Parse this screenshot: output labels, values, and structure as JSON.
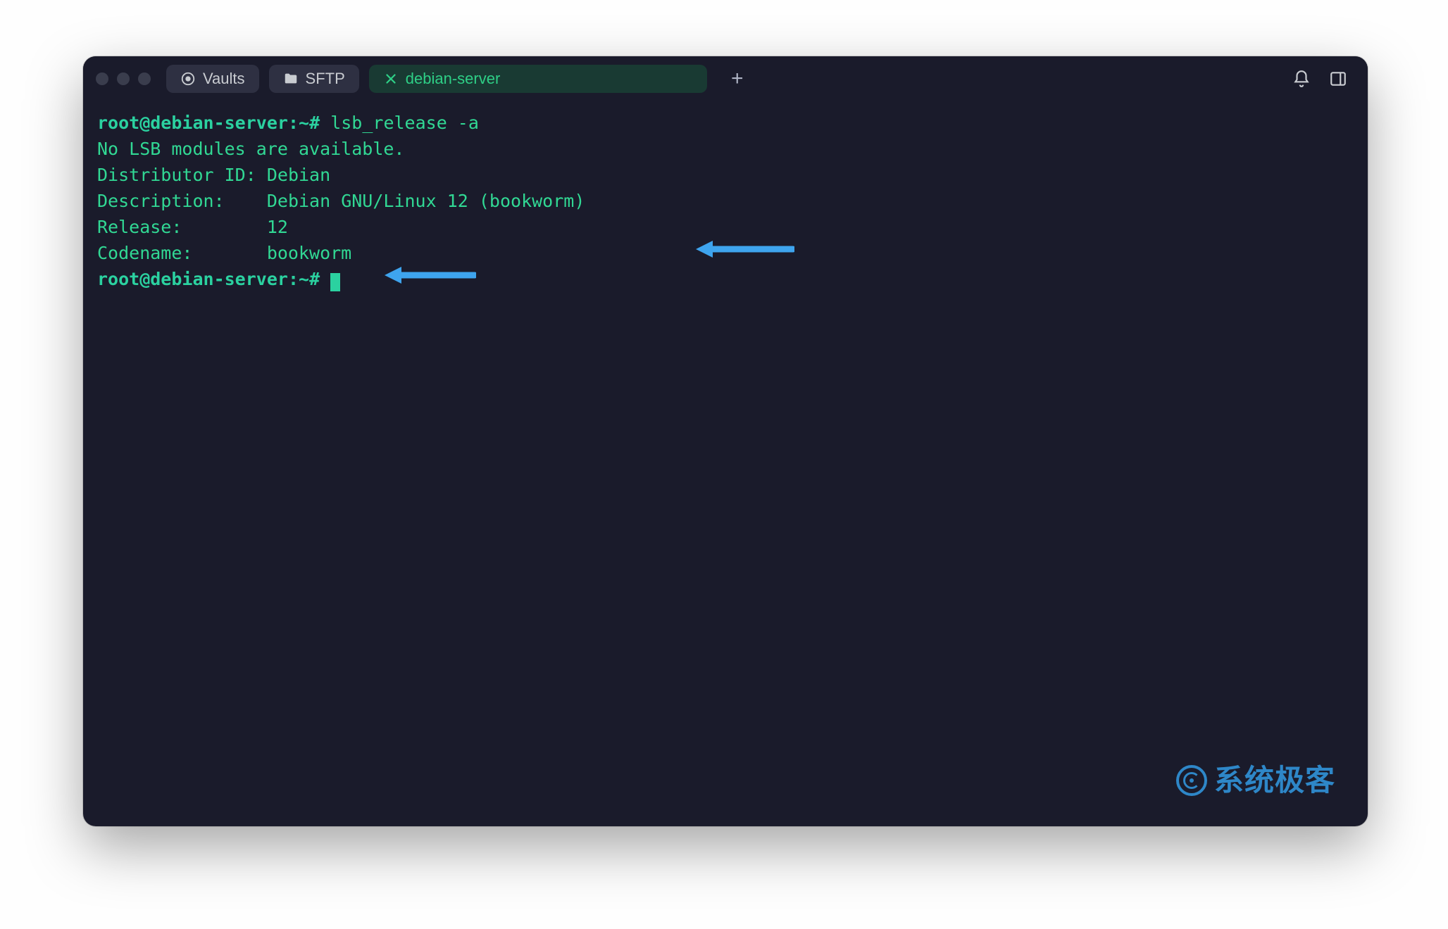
{
  "tabs": {
    "vaults": "Vaults",
    "sftp": "SFTP",
    "active": "debian-server"
  },
  "term": {
    "prompt_user": "root@debian-server",
    "prompt_path": "~",
    "prompt_symbol": "#",
    "command": "lsb_release -a",
    "lines": {
      "no_lsb": "No LSB modules are available.",
      "distributor_label": "Distributor ID:",
      "distributor_value": "Debian",
      "description_label": "Description:",
      "description_value": "Debian GNU/Linux 12 (bookworm)",
      "release_label": "Release:",
      "release_value": "12",
      "codename_label": "Codename:",
      "codename_value": "bookworm"
    }
  },
  "watermark": "系统极客"
}
